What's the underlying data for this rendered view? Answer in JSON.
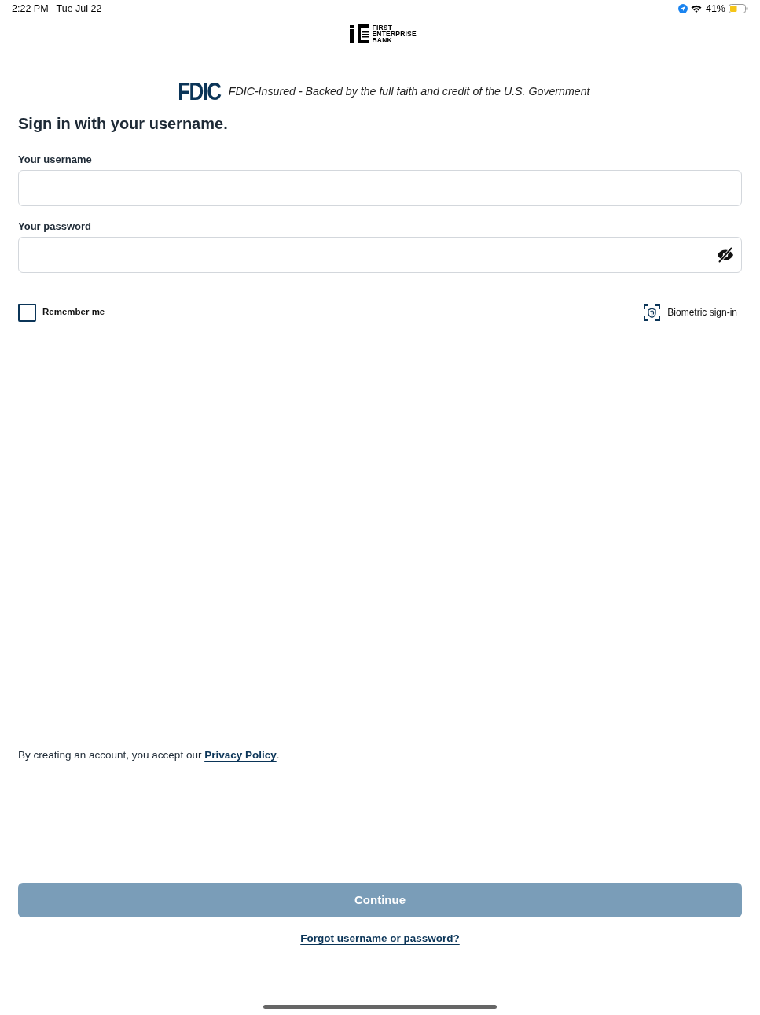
{
  "status_bar": {
    "time": "2:22 PM",
    "date": "Tue Jul 22",
    "battery": "41%"
  },
  "header": {
    "logo_lines": [
      "FIRST",
      "ENTERPRISE",
      "BANK"
    ]
  },
  "fdic": {
    "mark": "FDIC",
    "text": "FDIC-Insured - Backed by the full faith and credit of the U.S. Government"
  },
  "form": {
    "title": "Sign in with your username.",
    "fields": [
      {
        "kind": "text",
        "label": "Your username"
      },
      {
        "kind": "password",
        "label": "Your password"
      }
    ],
    "remember": {
      "label": "Remember me",
      "checked": false
    },
    "biometric": {
      "label": "Biometric sign-in"
    }
  },
  "consent": {
    "text": "By creating an account, you accept our",
    "link": "Privacy Policy",
    "end": "."
  },
  "continue_button": {
    "label": "Continue",
    "disabled": true
  },
  "forgot_link": "Forgot username or password?"
}
